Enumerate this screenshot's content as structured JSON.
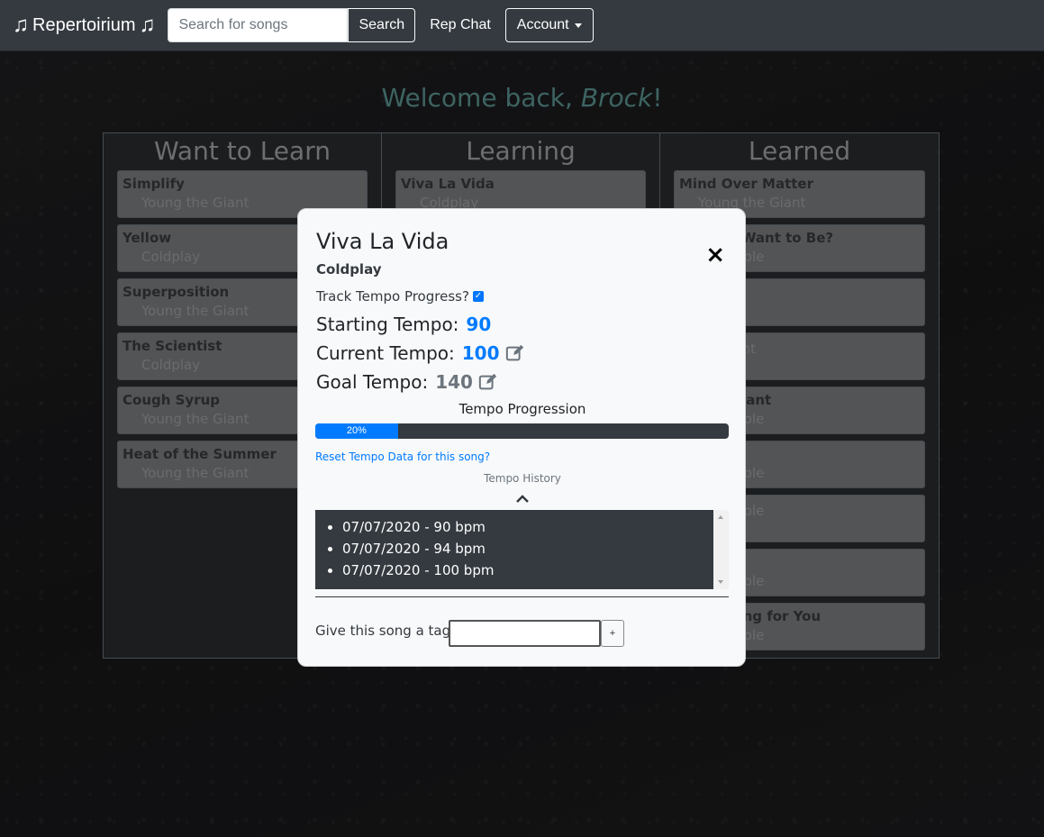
{
  "navbar": {
    "brand": "Repertoirium",
    "brand_icon_left": "music-note-icon",
    "brand_icon_right": "music-note-icon",
    "search_placeholder": "Search for songs",
    "search_button": "Search",
    "rep_chat": "Rep Chat",
    "account": "Account"
  },
  "welcome": {
    "prefix": "Welcome back, ",
    "name": "Brock",
    "suffix": "!"
  },
  "board": {
    "columns": [
      {
        "title": "Want to Learn",
        "cards": [
          {
            "song": "Simplify",
            "artist": "Young the Giant"
          },
          {
            "song": "Yellow",
            "artist": "Coldplay"
          },
          {
            "song": "Superposition",
            "artist": "Young the Giant"
          },
          {
            "song": "The Scientist",
            "artist": "Coldplay"
          },
          {
            "song": "Cough Syrup",
            "artist": "Young the Giant"
          },
          {
            "song": "Heat of the Summer",
            "artist": "Young the Giant"
          }
        ]
      },
      {
        "title": "Learning",
        "cards": [
          {
            "song": "Viva La Vida",
            "artist": "Coldplay"
          }
        ]
      },
      {
        "title": "Learned",
        "cards": [
          {
            "song": "Mind Over Matter",
            "artist": "Young the Giant"
          },
          {
            "song": "hat You Want to Be?",
            "artist": "he People"
          },
          {
            "song": "",
            "artist": "y"
          },
          {
            "song": "",
            "artist": "he Giant"
          },
          {
            "song": "at You Want",
            "artist": "he People"
          },
          {
            "song": "p Kicks",
            "artist": "he People"
          },
          {
            "song": "",
            "artist": "he People"
          },
          {
            "song": "Me",
            "artist": "he People"
          },
          {
            "song": "o Anything for You",
            "artist": "he People"
          }
        ]
      }
    ]
  },
  "modal": {
    "title": "Viva La Vida",
    "artist": "Coldplay",
    "close": "×",
    "track_label": "Track Tempo Progress?",
    "track_checked": true,
    "starting_label": "Starting Tempo:",
    "starting_value": "90",
    "current_label": "Current Tempo:",
    "current_value": "100",
    "goal_label": "Goal Tempo:",
    "goal_value": "140",
    "progress_title": "Tempo Progression",
    "progress_percent": 20,
    "progress_text": "20%",
    "reset_link": "Reset Tempo Data for this song?",
    "history_title": "Tempo History",
    "history": [
      "07/07/2020 - 90 bpm",
      "07/07/2020 - 94 bpm",
      "07/07/2020 - 100 bpm"
    ],
    "tag_label": "Give this song a tag",
    "tag_add": "+",
    "colors": {
      "accent": "#007bff",
      "dark": "#343a40",
      "welcome": "#5e9a97"
    }
  }
}
